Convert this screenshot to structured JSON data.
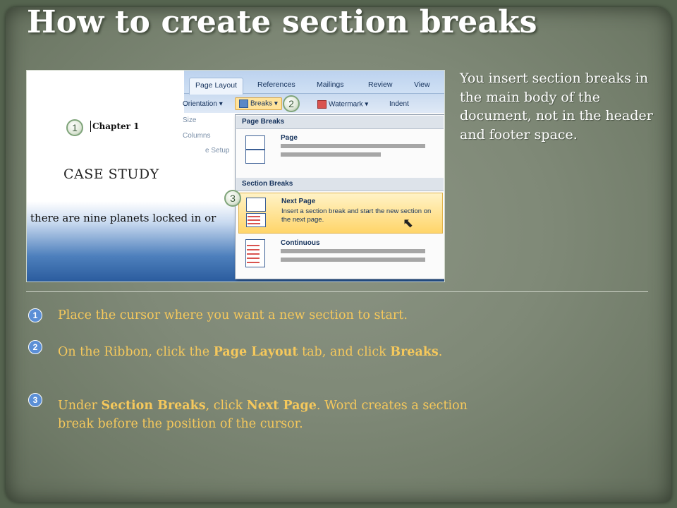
{
  "title": "How to create section breaks",
  "side_note": "You insert section breaks in the main body of the document, not in the header and footer space.",
  "screenshot": {
    "tabs": [
      "Page Layout",
      "References",
      "Mailings",
      "Review",
      "View"
    ],
    "ribbon_buttons": {
      "orientation": "Orientation",
      "breaks": "Breaks",
      "watermark": "Watermark",
      "indent": "Indent",
      "size": "Size",
      "columns": "Columns",
      "setup": "e Setup"
    },
    "doc": {
      "chapter": "Chapter 1",
      "case_study": "CASE STUDY",
      "body": "there are nine planets locked in or"
    },
    "menu": {
      "page_breaks_header": "Page Breaks",
      "page_title": "Page",
      "section_breaks_header": "Section Breaks",
      "next_page_title": "Next Page",
      "next_page_desc": "Insert a section break and start the new section on the next page.",
      "continuous_title": "Continuous"
    },
    "callouts": [
      "1",
      "2",
      "3"
    ]
  },
  "steps": [
    {
      "num": "1",
      "text": "Place the cursor where you want a new section to start."
    },
    {
      "num": "2",
      "pre": "On the Ribbon, click the ",
      "b1": "Page Layout",
      "mid": " tab, and click ",
      "b2": "Breaks",
      "post": "."
    },
    {
      "num": "3",
      "pre": "Under ",
      "b1": "Section Breaks",
      "mid": ", click ",
      "b2": "Next Page",
      "post": ". Word creates a section break before the position of the cursor."
    }
  ]
}
